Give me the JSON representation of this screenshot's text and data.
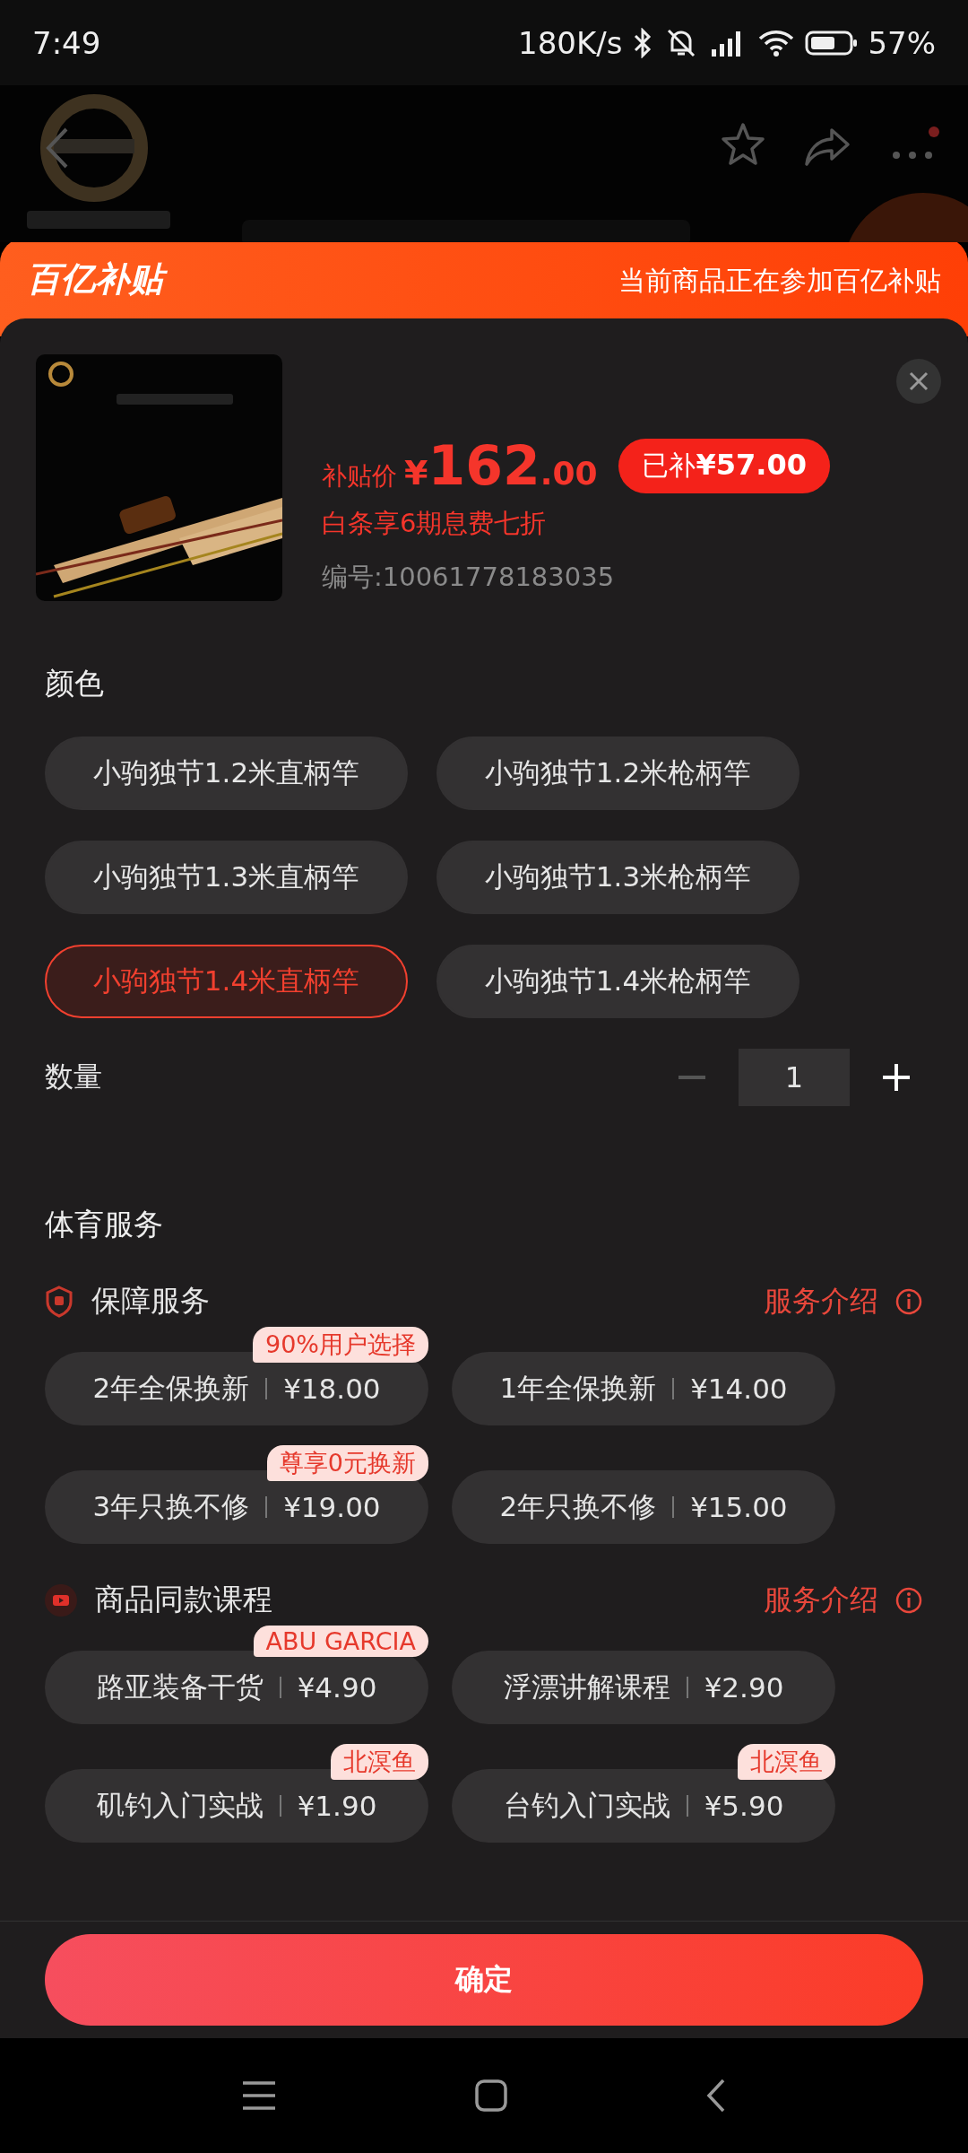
{
  "status_bar": {
    "time": "7:49",
    "network_speed": "180K/s",
    "battery": "57%"
  },
  "banner": {
    "logo": "百亿补贴",
    "note": "当前商品正在参加百亿补贴"
  },
  "product": {
    "price_label": "补贴价",
    "price_currency": "¥",
    "price_integer": "162",
    "price_decimal": ".00",
    "subsidy_label": "已补",
    "subsidy_amount": "¥57.00",
    "installment": "白条享6期息费七折",
    "sku_number": "编号:10061778183035"
  },
  "color_section": {
    "title": "颜色",
    "options": [
      {
        "label": "小驹独节1.2米直柄竿",
        "selected": false
      },
      {
        "label": "小驹独节1.2米枪柄竿",
        "selected": false
      },
      {
        "label": "小驹独节1.3米直柄竿",
        "selected": false
      },
      {
        "label": "小驹独节1.3米枪柄竿",
        "selected": false
      },
      {
        "label": "小驹独节1.4米直柄竿",
        "selected": true
      },
      {
        "label": "小驹独节1.4米枪柄竿",
        "selected": false
      }
    ]
  },
  "quantity": {
    "title": "数量",
    "value": "1",
    "decrease_disabled": true
  },
  "services": {
    "title": "体育服务",
    "groups": [
      {
        "kind": "shield",
        "title": "保障服务",
        "link": "服务介绍",
        "options": [
          {
            "name": "2年全保换新",
            "price": "¥18.00",
            "tag": "90%用户选择"
          },
          {
            "name": "1年全保换新",
            "price": "¥14.00"
          },
          {
            "name": "3年只换不修",
            "price": "¥19.00",
            "tag": "尊享0元换新"
          },
          {
            "name": "2年只换不修",
            "price": "¥15.00"
          }
        ]
      },
      {
        "kind": "video",
        "title": "商品同款课程",
        "link": "服务介绍",
        "options": [
          {
            "name": "路亚装备干货",
            "price": "¥4.90",
            "tag": "ABU GARCIA"
          },
          {
            "name": "浮漂讲解课程",
            "price": "¥2.90"
          },
          {
            "name": "矶钓入门实战",
            "price": "¥1.90",
            "tag": "北溟鱼"
          },
          {
            "name": "台钓入门实战",
            "price": "¥5.90",
            "tag": "北溟鱼"
          }
        ]
      }
    ]
  },
  "confirm_button": "确定"
}
